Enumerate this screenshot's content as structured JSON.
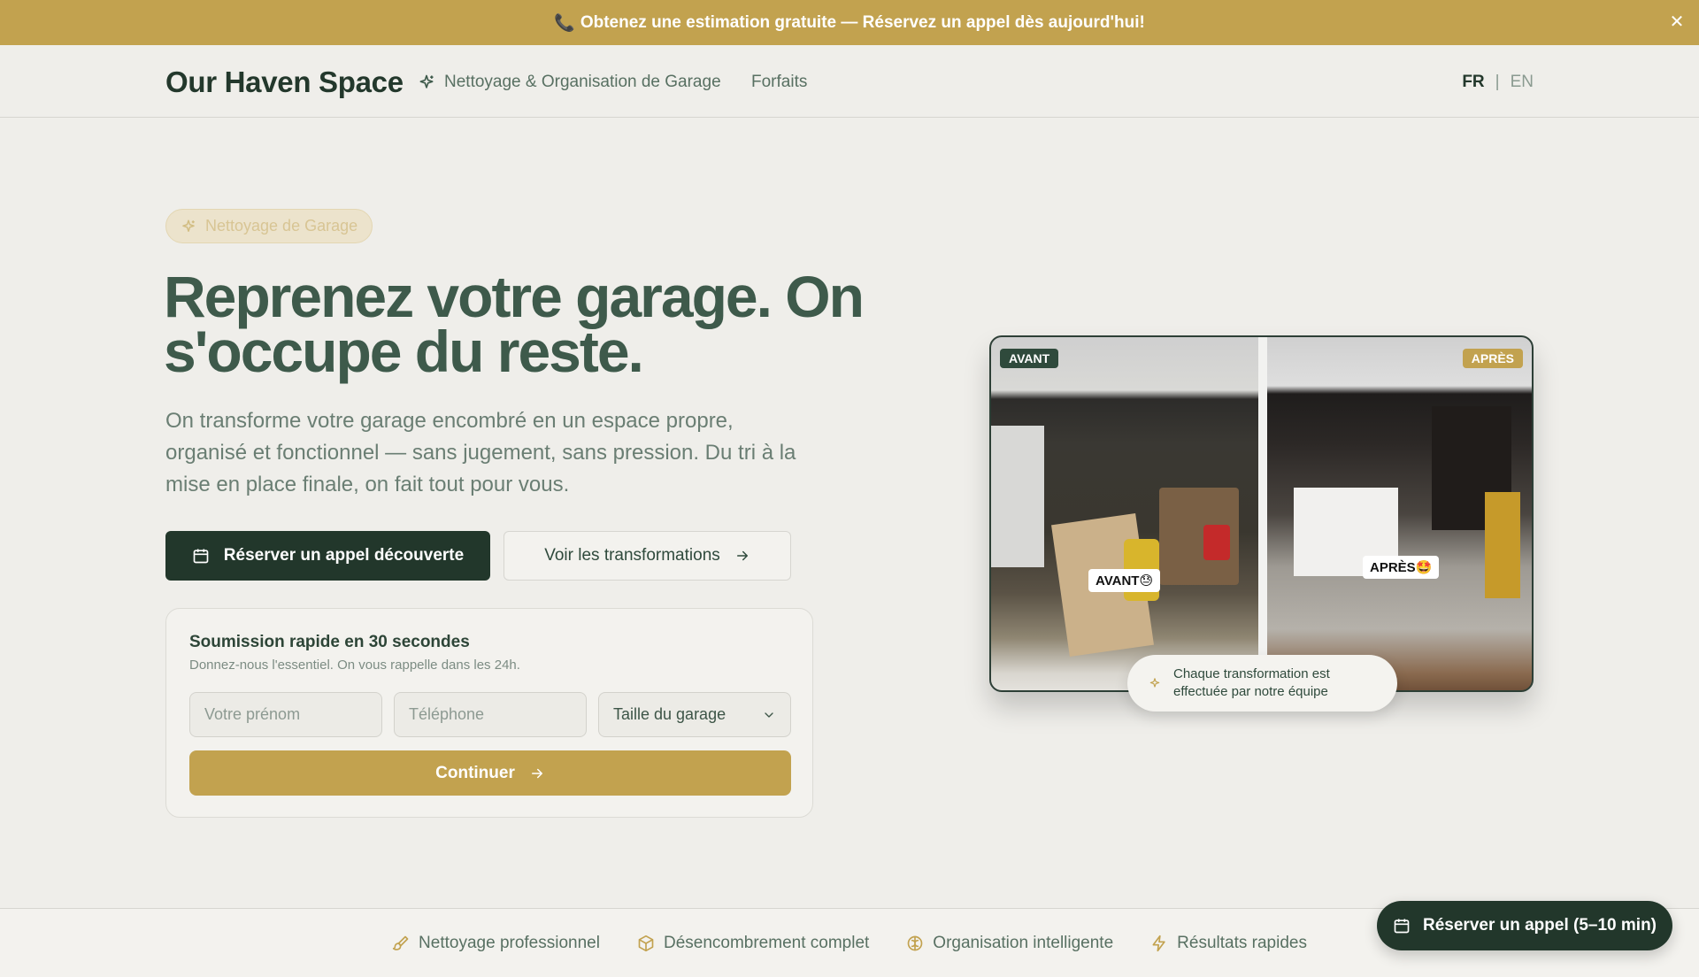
{
  "announcement": {
    "icon": "phone-icon",
    "text": "Obtenez une estimation gratuite — Réservez un appel dès aujourd'hui!",
    "close_glyph": "✕"
  },
  "header": {
    "brand": "Our Haven Space",
    "nav": [
      {
        "label": "Nettoyage & Organisation de Garage",
        "icon": "sparkles-icon"
      },
      {
        "label": "Forfaits"
      }
    ],
    "languages": {
      "active": "FR",
      "separator": "|",
      "other": "EN"
    }
  },
  "hero": {
    "badge": "Nettoyage de Garage",
    "title": "Reprenez votre garage. On s'occupe du reste.",
    "lead": "On transforme votre garage encombré en un espace propre, organisé et fonctionnel — sans jugement, sans pression. Du tri à la mise en place finale, on fait tout pour vous.",
    "primary_button": "Réserver un appel découverte",
    "secondary_button": "Voir les transformations"
  },
  "quick_form": {
    "title": "Soumission rapide en 30 secondes",
    "subtitle": "Donnez-nous l'essentiel. On vous rappelle dans les 24h.",
    "first_name_placeholder": "Votre prénom",
    "phone_placeholder": "Téléphone",
    "garage_size_selected": "Taille du garage",
    "submit": "Continuer"
  },
  "photo": {
    "before_tag": "AVANT",
    "after_tag": "APRÈS",
    "before_overlay": "AVANT😓",
    "after_overlay": "APRÈS🤩",
    "caption": "Chaque transformation est effectuée par notre équipe"
  },
  "features": [
    {
      "label": "Nettoyage professionnel",
      "icon": "brush-icon"
    },
    {
      "label": "Désencombrement complet",
      "icon": "box-icon"
    },
    {
      "label": "Organisation intelligente",
      "icon": "brain-icon"
    },
    {
      "label": "Résultats rapides",
      "icon": "lightning-icon"
    }
  ],
  "floating_button": "Réserver un appel (5–10 min)",
  "colors": {
    "gold": "#c2a24f",
    "dark_green": "#22372b",
    "text_green": "#3e5a4b",
    "background": "#efeeea"
  }
}
